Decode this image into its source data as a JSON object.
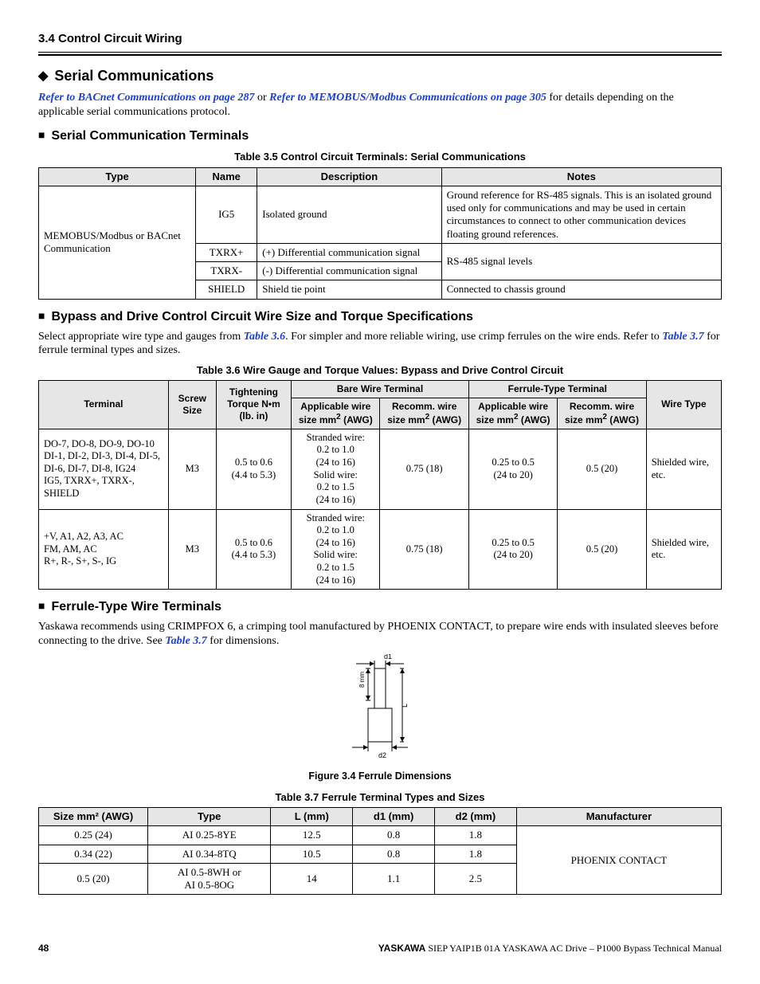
{
  "header": {
    "section": "3.4 Control Circuit Wiring"
  },
  "h1": "Serial Communications",
  "intro": {
    "pre": "",
    "link1": "Refer to BACnet Communications on page 287",
    "mid": " or ",
    "link2": "Refer to MEMOBUS/Modbus Communications on page 305",
    "post": " for details depending on the applicable serial communications protocol."
  },
  "h2a": "Serial Communication Terminals",
  "table35": {
    "caption": "Table 3.5  Control Circuit Terminals: Serial Communications",
    "headers": [
      "Type",
      "Name",
      "Description",
      "Notes"
    ],
    "typeCell": "MEMOBUS/Modbus or BACnet Communication",
    "rows": [
      {
        "name": "IG5",
        "desc": "Isolated ground",
        "notes": "Ground reference for RS-485 signals. This is an isolated ground used only for communications and may be used in certain circumstances to connect to other communication devices floating ground references."
      },
      {
        "name": "TXRX+",
        "desc": "(+) Differential communication signal",
        "notes": "RS-485 signal levels"
      },
      {
        "name": "TXRX-",
        "desc": "(-) Differential communication signal",
        "notes": ""
      },
      {
        "name": "SHIELD",
        "desc": "Shield tie point",
        "notes": "Connected to chassis ground"
      }
    ]
  },
  "h2b": "Bypass and Drive Control Circuit Wire Size and Torque Specifications",
  "p36a": "Select appropriate wire type and gauges from ",
  "p36link1": "Table 3.6",
  "p36b": ". For simpler and more reliable wiring, use crimp ferrules on the wire ends. Refer to ",
  "p36link2": "Table 3.7",
  "p36c": " for ferrule terminal types and sizes.",
  "table36": {
    "caption": "Table 3.6  Wire Gauge and Torque Values: Bypass and Drive Control Circuit",
    "h_terminal": "Terminal",
    "h_screw": "Screw Size",
    "h_torque": "Tightening Torque N•m (lb. in)",
    "h_bare": "Bare Wire Terminal",
    "h_ferr": "Ferrule-Type Terminal",
    "h_app": "Applicable wire size mm",
    "h_app_sup": "2",
    "h_app_suf": " (AWG)",
    "h_rec": "Recomm. wire size mm",
    "h_wiretype": "Wire Type",
    "rows": [
      {
        "terminal": "DO-7, DO-8, DO-9, DO-10\nDI-1, DI-2, DI-3, DI-4, DI-5, DI-6, DI-7, DI-8, IG24\nIG5, TXRX+, TXRX-, SHIELD",
        "screw": "M3",
        "torque": "0.5 to 0.6\n(4.4 to 5.3)",
        "bare_app": "Stranded wire:\n0.2 to 1.0\n(24 to 16)\nSolid wire:\n0.2 to 1.5\n(24 to 16)",
        "bare_rec": "0.75 (18)",
        "ferr_app": "0.25 to 0.5\n(24 to 20)",
        "ferr_rec": "0.5 (20)",
        "wiretype": "Shielded wire, etc."
      },
      {
        "terminal": "+V, A1, A2, A3, AC\nFM, AM, AC\nR+, R-, S+, S-, IG",
        "screw": "M3",
        "torque": "0.5 to 0.6\n(4.4 to 5.3)",
        "bare_app": "Stranded wire:\n0.2 to 1.0\n(24 to 16)\nSolid wire:\n0.2 to 1.5\n(24 to 16)",
        "bare_rec": "0.75 (18)",
        "ferr_app": "0.25 to 0.5\n(24 to 20)",
        "ferr_rec": "0.5 (20)",
        "wiretype": "Shielded wire, etc."
      }
    ]
  },
  "h2c": "Ferrule-Type Wire Terminals",
  "p37a": "Yaskawa recommends using CRIMPFOX 6, a crimping tool manufactured by PHOENIX CONTACT, to prepare wire ends with insulated sleeves before connecting to the drive. See ",
  "p37link": "Table 3.7",
  "p37b": " for dimensions.",
  "fig34": {
    "caption": "Figure 3.4  Ferrule Dimensions",
    "d1": "d1",
    "d2": "d2",
    "L": "L",
    "eight": "8 mm"
  },
  "table37": {
    "caption": "Table 3.7  Ferrule Terminal Types and Sizes",
    "headers": [
      "Size mm² (AWG)",
      "Type",
      "L (mm)",
      "d1 (mm)",
      "d2 (mm)",
      "Manufacturer"
    ],
    "rows": [
      {
        "c": [
          "0.25 (24)",
          "AI 0.25-8YE",
          "12.5",
          "0.8",
          "1.8"
        ]
      },
      {
        "c": [
          "0.34 (22)",
          "AI 0.34-8TQ",
          "10.5",
          "0.8",
          "1.8"
        ]
      },
      {
        "c": [
          "0.5 (20)",
          "AI 0.5-8WH or\nAI 0.5-8OG",
          "14",
          "1.1",
          "2.5"
        ]
      }
    ],
    "manufacturer": "PHOENIX CONTACT"
  },
  "footer": {
    "page": "48",
    "brand": "YASKAWA",
    "doc": " SIEP YAIP1B 01A YASKAWA AC Drive – P1000 Bypass Technical Manual"
  }
}
